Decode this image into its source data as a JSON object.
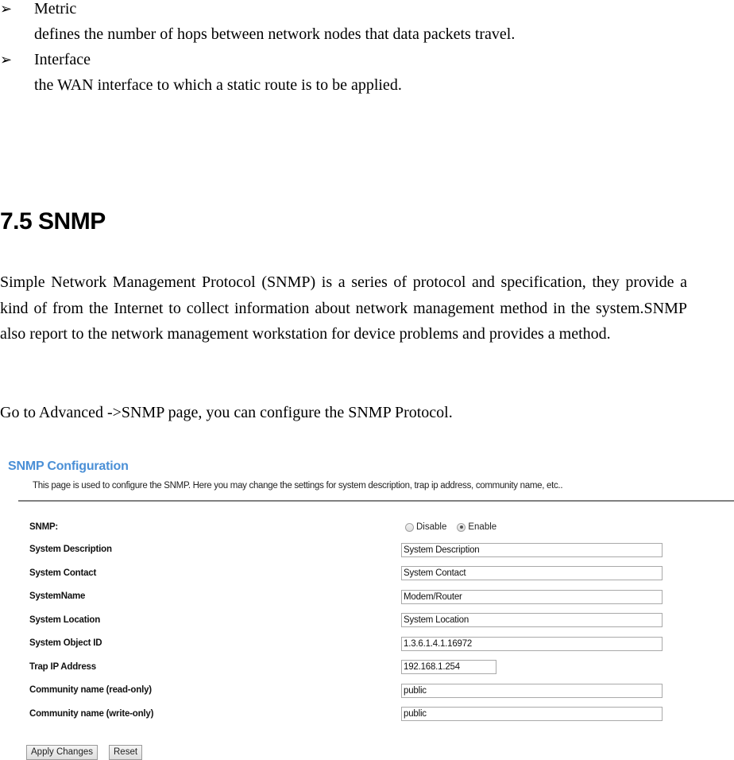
{
  "bullets": [
    {
      "icon": "arrow-bullet-icon",
      "term": "Metric",
      "description": "defines the number of hops between network nodes that data packets travel."
    },
    {
      "icon": "arrow-bullet-icon",
      "term": "Interface",
      "description": "the WAN interface to which a static route is to be applied."
    }
  ],
  "section": {
    "heading": "7.5 SNMP",
    "paragraph1": "Simple Network Management Protocol (SNMP) is a series of protocol and specification, they provide a kind of from the Internet to collect information about network management method in the system.SNMP also report to the network management workstation for device problems and provides a method.",
    "paragraph2": "Go to Advanced ->SNMP page, you can configure the SNMP Protocol."
  },
  "snmp_config": {
    "title": "SNMP Configuration",
    "description": "This page is used to configure the SNMP. Here you may change the settings for system description, trap ip address, community name, etc..",
    "snmp_label": "SNMP:",
    "radio_options": [
      {
        "label": "Disable",
        "checked": false
      },
      {
        "label": "Enable",
        "checked": true
      }
    ],
    "fields": [
      {
        "label": "System Description",
        "value": "System Description"
      },
      {
        "label": "System Contact",
        "value": "System Contact"
      },
      {
        "label": "SystemName",
        "value": "Modem/Router"
      },
      {
        "label": "System Location",
        "value": "System Location"
      },
      {
        "label": "System Object ID",
        "value": "1.3.6.1.4.1.16972"
      },
      {
        "label": "Trap IP Address",
        "value": "192.168.1.254"
      },
      {
        "label": "Community name (read-only)",
        "value": "public"
      },
      {
        "label": "Community name (write-only)",
        "value": "public"
      }
    ],
    "buttons": {
      "apply": "Apply Changes",
      "reset": "Reset"
    },
    "colors": {
      "title": "#4a8fd6"
    }
  }
}
